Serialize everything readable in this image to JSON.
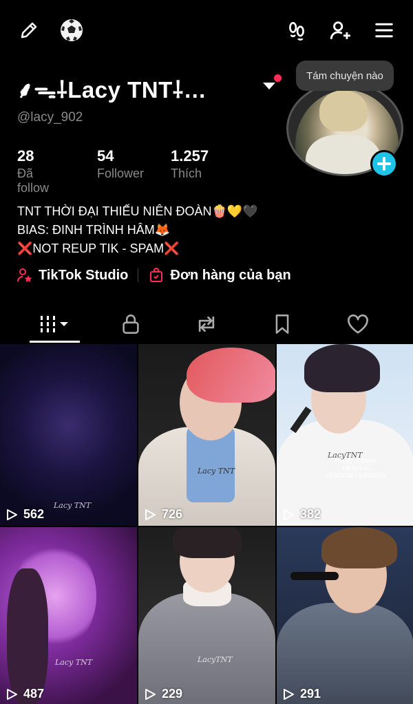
{
  "profile": {
    "display_name": "⸙ᯓ⸸Lacy TNT⸸…",
    "username": "@lacy_902",
    "bubble_text": "Tám chuyện nào",
    "stats": [
      {
        "value": "28",
        "label": "Đã follow"
      },
      {
        "value": "54",
        "label": "Follower"
      },
      {
        "value": "1.257",
        "label": "Thích"
      }
    ],
    "bio": [
      "TNT THỜI ĐẠI THIẾU NIÊN ĐOÀN🍿💛🖤",
      "BIAS: ĐINH TRÌNH HÂM🦊",
      "❌NOT REUP TIK - SPAM❌"
    ],
    "links": [
      {
        "label": "TikTok Studio",
        "icon": "studio-person-icon"
      },
      {
        "label": "Đơn hàng của bạn",
        "icon": "shopping-bag-icon"
      }
    ]
  },
  "tabs": [
    {
      "name": "videos",
      "icon": "grid-icon",
      "active": true
    },
    {
      "name": "private",
      "icon": "lock-icon",
      "active": false
    },
    {
      "name": "reposts",
      "icon": "repost-icon",
      "active": false
    },
    {
      "name": "favorites",
      "icon": "bookmark-icon",
      "active": false
    },
    {
      "name": "liked",
      "icon": "heart-icon",
      "active": false
    }
  ],
  "videos": [
    {
      "views": "562",
      "watermark": "Lacy TNT"
    },
    {
      "views": "726",
      "watermark": "Lacy TNT"
    },
    {
      "views": "382",
      "watermark": "LacyTNT",
      "overlay": "Happy birthday\nHeJunLin\n19/6/2004 - 19/6/2025"
    },
    {
      "views": "487",
      "watermark": "Lacy TNT"
    },
    {
      "views": "229",
      "watermark": "LacyTNT"
    },
    {
      "views": "291",
      "watermark": ""
    }
  ],
  "colors": {
    "background": "#000000",
    "accent_red": "#ff2c55",
    "add_button": "#20c3e8",
    "muted_text": "#8a8a8a"
  }
}
